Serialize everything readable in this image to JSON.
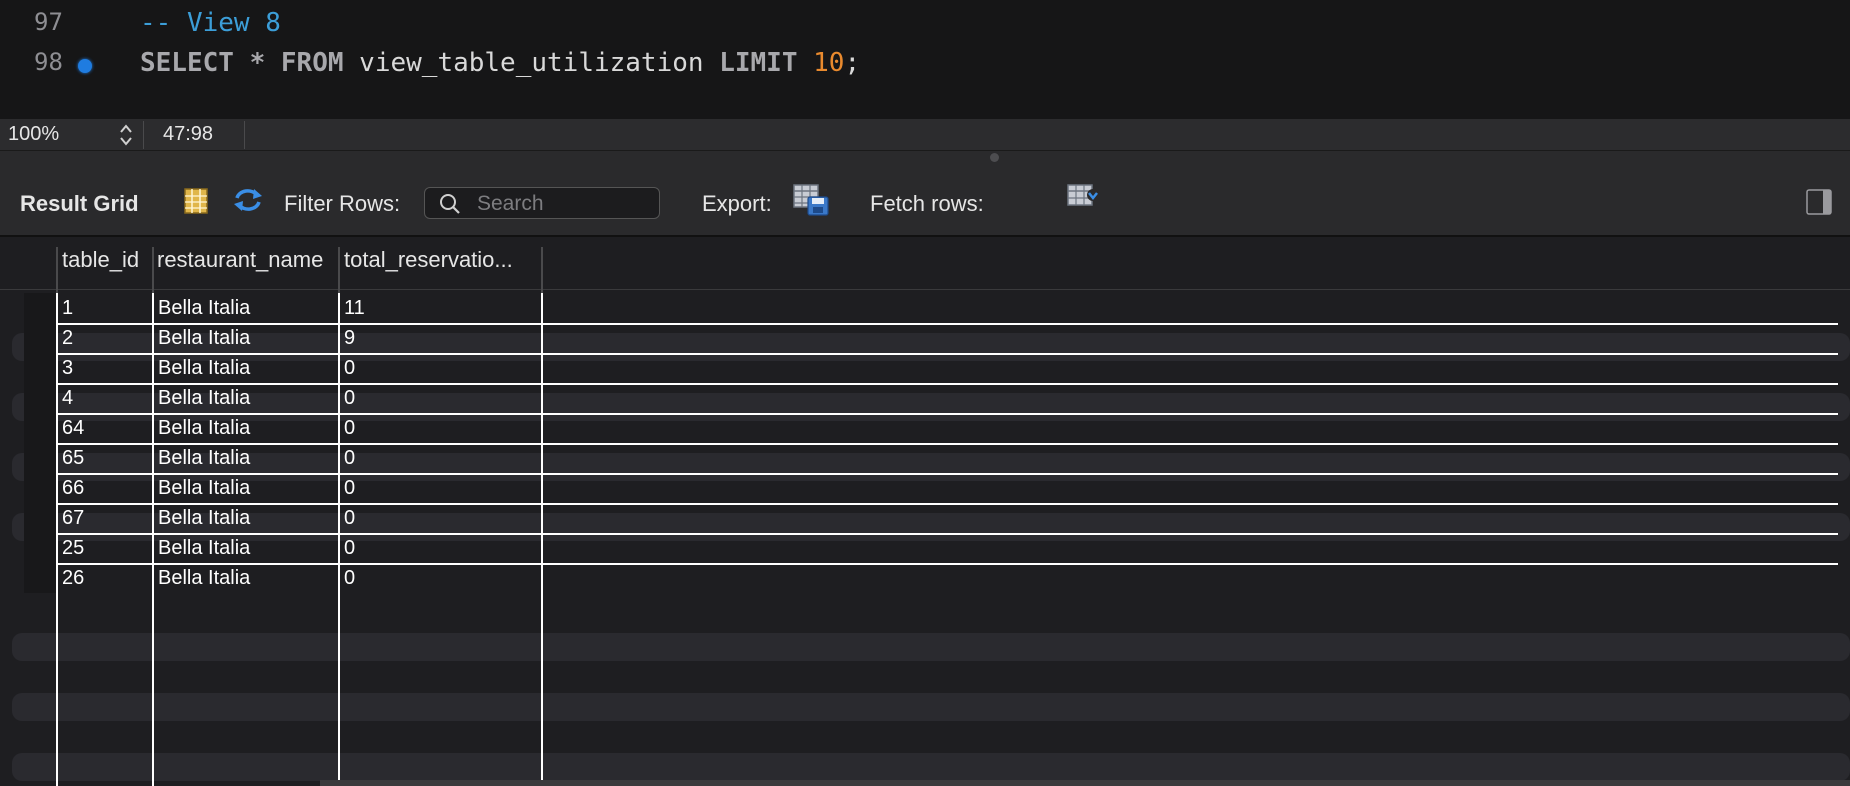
{
  "editor": {
    "lines": [
      {
        "number": "97",
        "comment": "-- View 8"
      },
      {
        "number": "98",
        "kw1": "SELECT",
        "star": "*",
        "kw2": "FROM",
        "table": "view_table_utilization",
        "kw3": "LIMIT",
        "limit": "10",
        "end": ";"
      }
    ]
  },
  "statusbar": {
    "zoom": "100%",
    "cursor": "47:98"
  },
  "toolbar": {
    "result_grid": "Result Grid",
    "filter_rows": "Filter Rows:",
    "search_placeholder": "Search",
    "export": "Export:",
    "fetch_rows": "Fetch rows:"
  },
  "grid": {
    "columns": [
      "table_id",
      "restaurant_name",
      "total_reservatio..."
    ],
    "rows": [
      [
        "1",
        "Bella Italia",
        "11"
      ],
      [
        "2",
        "Bella Italia",
        "9"
      ],
      [
        "3",
        "Bella Italia",
        "0"
      ],
      [
        "4",
        "Bella Italia",
        "0"
      ],
      [
        "64",
        "Bella Italia",
        "0"
      ],
      [
        "65",
        "Bella Italia",
        "0"
      ],
      [
        "66",
        "Bella Italia",
        "0"
      ],
      [
        "67",
        "Bella Italia",
        "0"
      ],
      [
        "25",
        "Bella Italia",
        "0"
      ],
      [
        "26",
        "Bella Italia",
        "0"
      ]
    ]
  },
  "colors": {
    "accent": "#1f7ce0",
    "comment": "#3c9ed8",
    "number": "#e98a2e"
  }
}
